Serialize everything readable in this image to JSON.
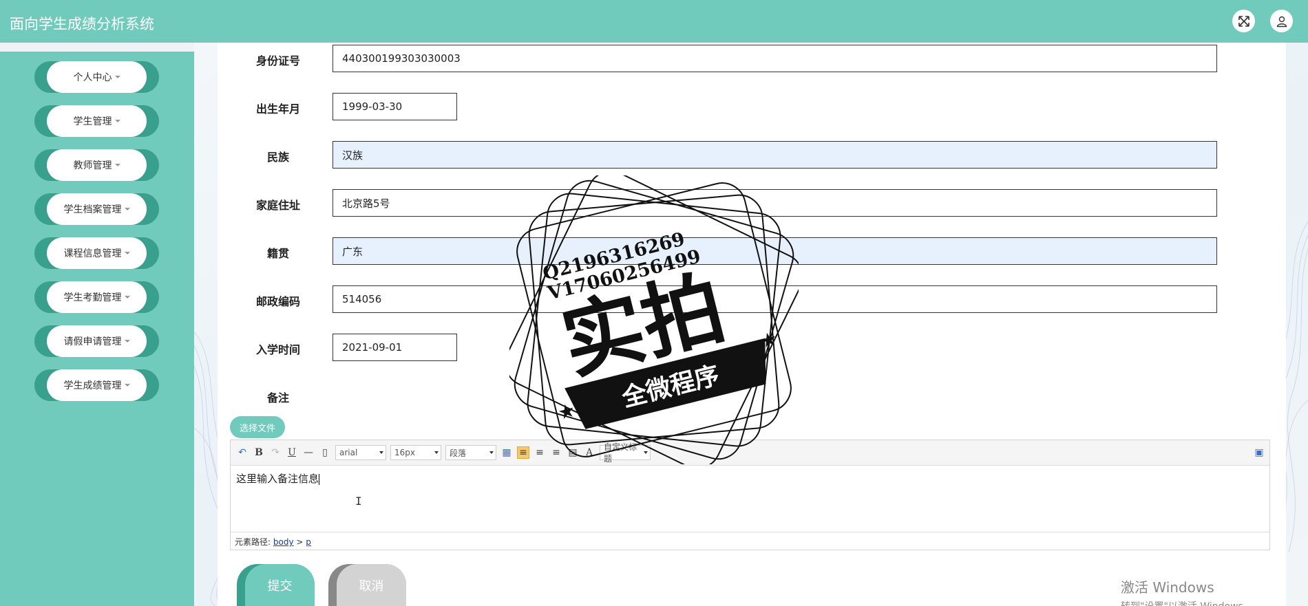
{
  "header": {
    "title": "面向学生成绩分析系统",
    "fullscreen_icon": "fullscreen-icon",
    "user_icon": "user-icon"
  },
  "sidebar": {
    "items": [
      {
        "label": "个人中心"
      },
      {
        "label": "学生管理"
      },
      {
        "label": "教师管理"
      },
      {
        "label": "学生档案管理"
      },
      {
        "label": "课程信息管理"
      },
      {
        "label": "学生考勤管理"
      },
      {
        "label": "请假申请管理"
      },
      {
        "label": "学生成绩管理"
      }
    ]
  },
  "form": {
    "id_card": {
      "label": "身份证号",
      "value": "440300199303030003"
    },
    "birth": {
      "label": "出生年月",
      "value": "1999-03-30"
    },
    "ethnicity": {
      "label": "民族",
      "value": "汉族"
    },
    "address": {
      "label": "家庭住址",
      "value": "北京路5号"
    },
    "native_place": {
      "label": "籍贯",
      "value": "广东"
    },
    "postcode": {
      "label": "邮政编码",
      "value": "514056"
    },
    "enroll_date": {
      "label": "入学时间",
      "value": "2021-09-01"
    },
    "remark": {
      "label": "备注"
    }
  },
  "file_button": "选择文件",
  "editor": {
    "font": "arial",
    "size": "16px",
    "paragraph": "段落",
    "custom_title": "自定义标题",
    "content": "这里输入备注信息",
    "path_label": "元素路径:",
    "path_body": "body",
    "path_sep": ">",
    "path_p": "p"
  },
  "actions": {
    "submit": "提交",
    "cancel": "取消"
  },
  "watermark": {
    "line1": "Q2196316269",
    "line2": "V17060256499",
    "main": "实拍",
    "banner": "全微程序"
  },
  "windows_activation": {
    "line1": "激活 Windows",
    "line2": "转到\"设置\"以激活 Windows。"
  },
  "colors": {
    "primary": "#70cbbd",
    "primary_dark": "#3aa08e",
    "input_highlight": "#e7f0fd"
  }
}
